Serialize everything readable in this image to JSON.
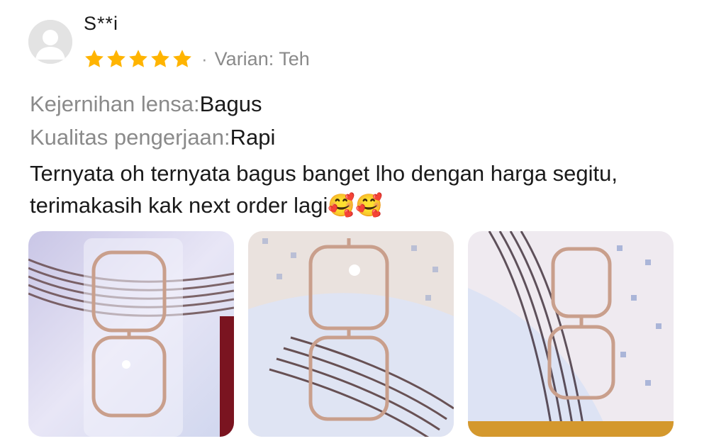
{
  "review": {
    "username": "S**i",
    "rating": 5,
    "rating_max": 5,
    "separator": "·",
    "variant": "Varian: Teh",
    "attributes": [
      {
        "label": "Kejernihan lensa:",
        "value": "Bagus"
      },
      {
        "label": "Kualitas pengerjaan:",
        "value": "Rapi"
      }
    ],
    "comment_text": "Ternyata oh ternyata bagus banget lho dengan harga segitu, terimakasih kak next order lagi",
    "comment_emoji": "🥰🥰",
    "photos": [
      {
        "icon": "photo-eyeglasses-in-plastic-bag"
      },
      {
        "icon": "photo-eyeglasses-on-table"
      },
      {
        "icon": "photo-eyeglasses-angled"
      }
    ]
  },
  "colors": {
    "star": "#FFB400",
    "label_gray": "#8a8a8a",
    "avatar_bg": "#e3e3e3",
    "avatar_fg": "#ffffff"
  }
}
